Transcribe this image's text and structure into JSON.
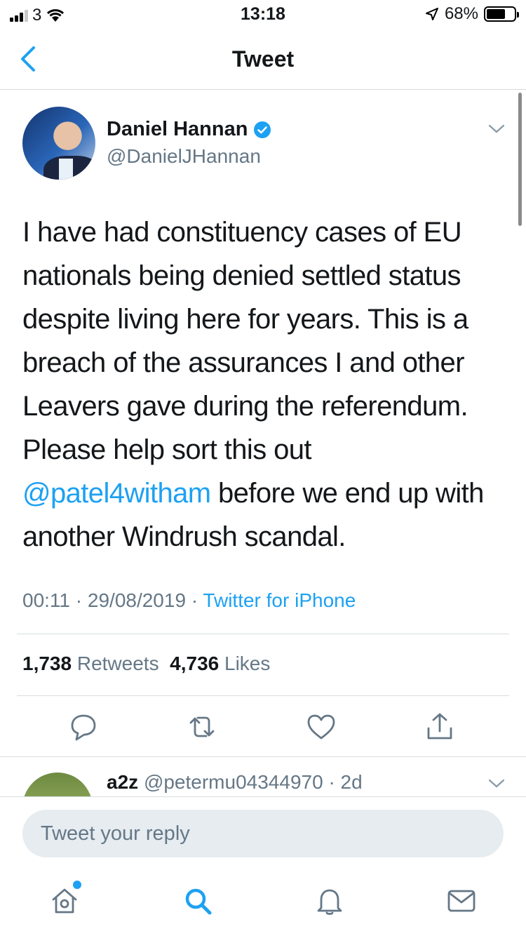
{
  "status_bar": {
    "carrier": "3",
    "time": "13:18",
    "battery": "68%",
    "battery_level": 0.68
  },
  "nav": {
    "title": "Tweet"
  },
  "tweet": {
    "name": "Daniel Hannan",
    "handle": "@DanielJHannan",
    "text_before": "I have had constituency cases of EU nationals being denied settled status despite living here for years. This is a breach of the assurances I and other Leavers gave during the referendum. Please help sort this out ",
    "mention": "@patel4witham",
    "text_after": " before we end up with another Windrush scandal.",
    "time": "00:11",
    "date": "29/08/2019",
    "source": "Twitter for iPhone",
    "retweets_count": "1,738",
    "retweets_label": "Retweets",
    "likes_count": "4,736",
    "likes_label": "Likes"
  },
  "reply_preview": {
    "name": "a2z",
    "handle": "@petermu04344970",
    "age": "2d"
  },
  "composer": {
    "placeholder": "Tweet your reply"
  },
  "colors": {
    "accent": "#1da1f2",
    "secondary_text": "#657786",
    "divider": "#d8dde1"
  }
}
